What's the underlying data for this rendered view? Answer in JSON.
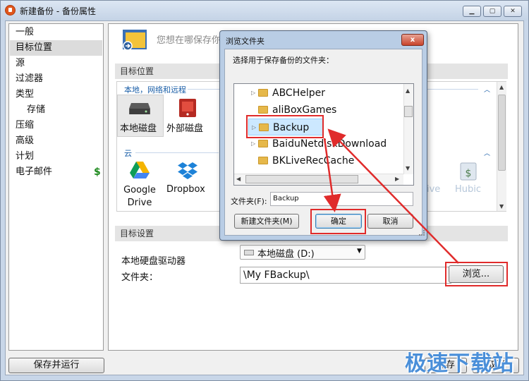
{
  "window": {
    "title": "新建备份 - 备份属性"
  },
  "sidebar": {
    "items": [
      {
        "label": "一般",
        "selected": false,
        "sub": false
      },
      {
        "label": "目标位置",
        "selected": true,
        "sub": false
      },
      {
        "label": "源",
        "selected": false,
        "sub": false
      },
      {
        "label": "过滤器",
        "selected": false,
        "sub": false
      },
      {
        "label": "类型",
        "selected": false,
        "sub": false
      },
      {
        "label": "存储",
        "selected": false,
        "sub": true
      },
      {
        "label": "压缩",
        "selected": false,
        "sub": false
      },
      {
        "label": "高级",
        "selected": false,
        "sub": false
      },
      {
        "label": "计划",
        "selected": false,
        "sub": false
      },
      {
        "label": "电子邮件",
        "selected": false,
        "sub": false
      }
    ],
    "email_badge": "$"
  },
  "main": {
    "prompt": "您想在哪保存你",
    "section_target": "目标位置",
    "group_local": "本地，网络和远程",
    "local_disk": "本地磁盘",
    "external_disk": "外部磁盘",
    "group_cloud": "云",
    "google_drive": "Google Drive",
    "dropbox": "Dropbox",
    "partial_ive": "ive",
    "hubic": "Hubic",
    "section_settings": "目标设置",
    "drive_label": "本地硬盘驱动器",
    "drive_value": "本地磁盘 (D:)",
    "folder_label": "文件夹：",
    "folder_value": "\\My FBackup\\",
    "browse": "浏览..."
  },
  "footer": {
    "run": "保存并运行",
    "save": "保存",
    "cancel": "取消"
  },
  "watermark": "极速下载站",
  "dialog": {
    "title": "浏览文件夹",
    "close": "x",
    "prompt": "选择用于保存备份的文件夹：",
    "tree": [
      {
        "label": "ABCHelper",
        "arrow": "▷",
        "selected": false
      },
      {
        "label": "aliBoxGames",
        "arrow": "",
        "selected": false
      },
      {
        "label": "Backup",
        "arrow": "▷",
        "selected": true
      },
      {
        "label": "BaiduNetdiskDownload",
        "arrow": "▷",
        "selected": false
      },
      {
        "label": "BKLiveRecCache",
        "arrow": "",
        "selected": false
      }
    ],
    "folder_label": "文件夹(F):",
    "folder_value": "Backup",
    "new_folder": "新建文件夹(M)",
    "ok": "确定",
    "cancel": "取消"
  },
  "colors": {
    "highlight_box": "#e02b2b",
    "selection": "#cce8ff",
    "accent": "#1b5fa8"
  }
}
